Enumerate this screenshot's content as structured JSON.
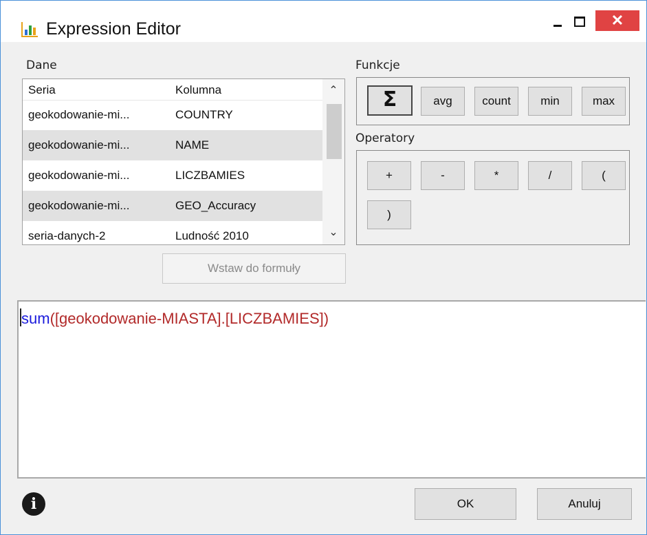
{
  "window": {
    "title": "Expression Editor",
    "close_glyph": "✕"
  },
  "dane": {
    "label": "Dane",
    "columns": {
      "seria": "Seria",
      "kolumna": "Kolumna"
    },
    "rows": [
      {
        "seria": "geokodowanie-mi...",
        "kolumna": "COUNTRY"
      },
      {
        "seria": "geokodowanie-mi...",
        "kolumna": "NAME"
      },
      {
        "seria": "geokodowanie-mi...",
        "kolumna": "LICZBAMIES"
      },
      {
        "seria": "geokodowanie-mi...",
        "kolumna": "GEO_Accuracy"
      },
      {
        "seria": "seria-danych-2",
        "kolumna": "Ludność 2010"
      }
    ],
    "insert_button": "Wstaw do formuły"
  },
  "funkcje": {
    "label": "Funkcje",
    "buttons": {
      "sum": "Σ",
      "avg": "avg",
      "count": "count",
      "min": "min",
      "max": "max"
    }
  },
  "operatory": {
    "label": "Operatory",
    "buttons": {
      "plus": "+",
      "minus": "-",
      "multiply": "*",
      "divide": "/",
      "lparen": "(",
      "rparen": ")"
    }
  },
  "editor": {
    "function": "sum",
    "open_paren": "(",
    "reference": "[geokodowanie-MIASTA].[LICZBAMIES]",
    "close_paren": ")"
  },
  "footer": {
    "info_glyph": "i",
    "ok": "OK",
    "cancel": "Anuluj"
  },
  "colors": {
    "keyword": "#1a1adc",
    "reference": "#b22a2a",
    "close_button": "#e04343",
    "window_border": "#4a90d9"
  }
}
